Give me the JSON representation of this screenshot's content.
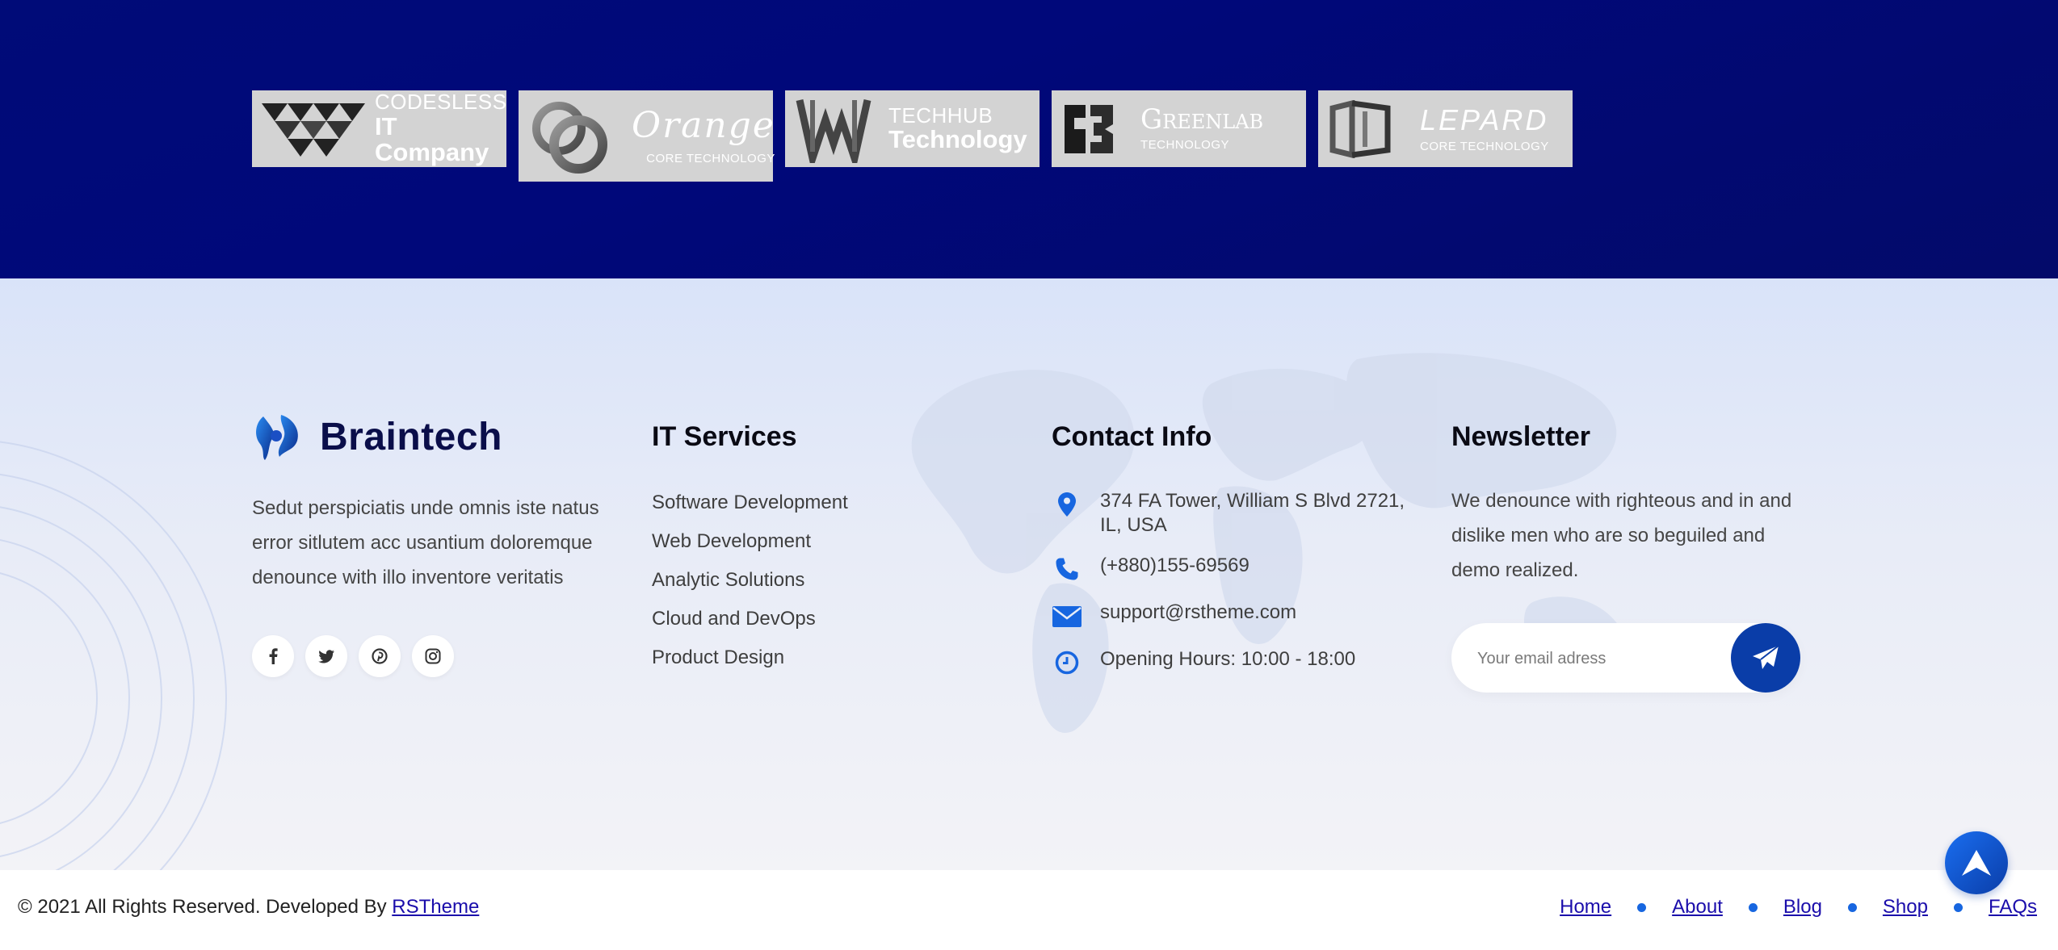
{
  "partners": [
    {
      "line1": "CODESLESS",
      "line2": "IT Company",
      "mark": "triangles-logo-mark"
    },
    {
      "line1": "",
      "line2": "Orange",
      "line3": "CORE TECHNOLOGY",
      "mark": "rings-logo-mark"
    },
    {
      "line1": "TECHHUB",
      "line2": "Technology",
      "mark": "w-logo-mark"
    },
    {
      "line1": "",
      "line2": "Greenlab",
      "line3": "TECHNOLOGY",
      "mark": "gb-logo-mark"
    },
    {
      "line1": "",
      "line2": "LEPARD",
      "line3": "CORE TECHNOLOGY",
      "mark": "frame-logo-mark"
    }
  ],
  "brand": {
    "name": "Braintech",
    "about": "Sedut perspiciatis unde omnis iste natus error sitlutem acc usantium doloremque denounce with illo inventore veritatis",
    "social": [
      "facebook-icon",
      "twitter-icon",
      "pinterest-icon",
      "instagram-icon"
    ]
  },
  "services": {
    "title": "IT Services",
    "items": [
      "Software Development",
      "Web Development",
      "Analytic Solutions",
      "Cloud and DevOps",
      "Product Design"
    ]
  },
  "contact": {
    "title": "Contact Info",
    "address": "374 FA Tower, William S Blvd 2721, IL, USA",
    "phone": "(+880)155-69569",
    "email": "support@rstheme.com",
    "hours": "Opening Hours: 10:00 - 18:00"
  },
  "newsletter": {
    "title": "Newsletter",
    "text": "We denounce with righteous and in and dislike men who are so beguiled and demo realized.",
    "placeholder": "Your email adress"
  },
  "footer_bottom": {
    "copyright": "© 2021 All Rights Reserved. Developed By",
    "developer": "RSTheme",
    "nav": [
      "Home",
      "About",
      "Blog",
      "Shop",
      "FAQs"
    ]
  },
  "colors": {
    "partners_bg": "#000b78",
    "accent": "#1766e0",
    "send_button": "#0a3da8",
    "heading": "#0a0a14"
  }
}
